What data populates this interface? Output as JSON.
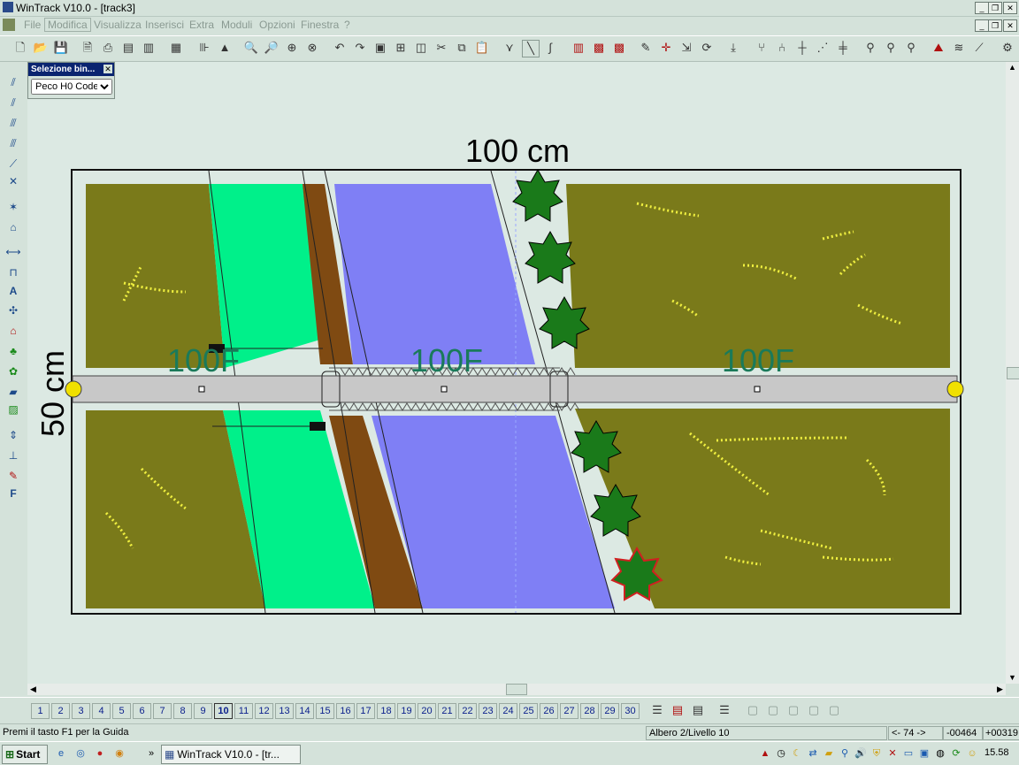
{
  "window": {
    "title": "WinTrack  V10.0 - [track3]"
  },
  "menu": [
    "File",
    "Modifica",
    "Visualizza",
    "Inserisci",
    "Extra",
    "Moduli",
    "Opzioni",
    "Finestra",
    "?"
  ],
  "palette": {
    "title": "Selezione bin...",
    "selected": "Peco H0 Code"
  },
  "drawing": {
    "width_label": "100 cm",
    "height_label": "50 cm",
    "track_labels": [
      "100F",
      "100F",
      "100F"
    ],
    "colors": {
      "board_bg": "#dce9e3",
      "grass": "#7a7a1a",
      "water": "#00f08a",
      "river": "#7f7ff5",
      "earth": "#7f4a12",
      "track": "#c8c8c8",
      "tree": "#1a7a1a"
    }
  },
  "layers": [
    "1",
    "2",
    "3",
    "4",
    "5",
    "6",
    "7",
    "8",
    "9",
    "10",
    "11",
    "12",
    "13",
    "14",
    "15",
    "16",
    "17",
    "18",
    "19",
    "20",
    "21",
    "22",
    "23",
    "24",
    "25",
    "26",
    "27",
    "28",
    "29",
    "30"
  ],
  "status": {
    "help": "Premi il tasto F1 per la Guida",
    "layer": "Albero 2/Livello 10",
    "pos": "<- 74 ->",
    "x": "-00464",
    "y": "+00319"
  },
  "taskbar": {
    "start": "Start",
    "task": "WinTrack  V10.0 - [tr...",
    "clock": "15.58"
  }
}
